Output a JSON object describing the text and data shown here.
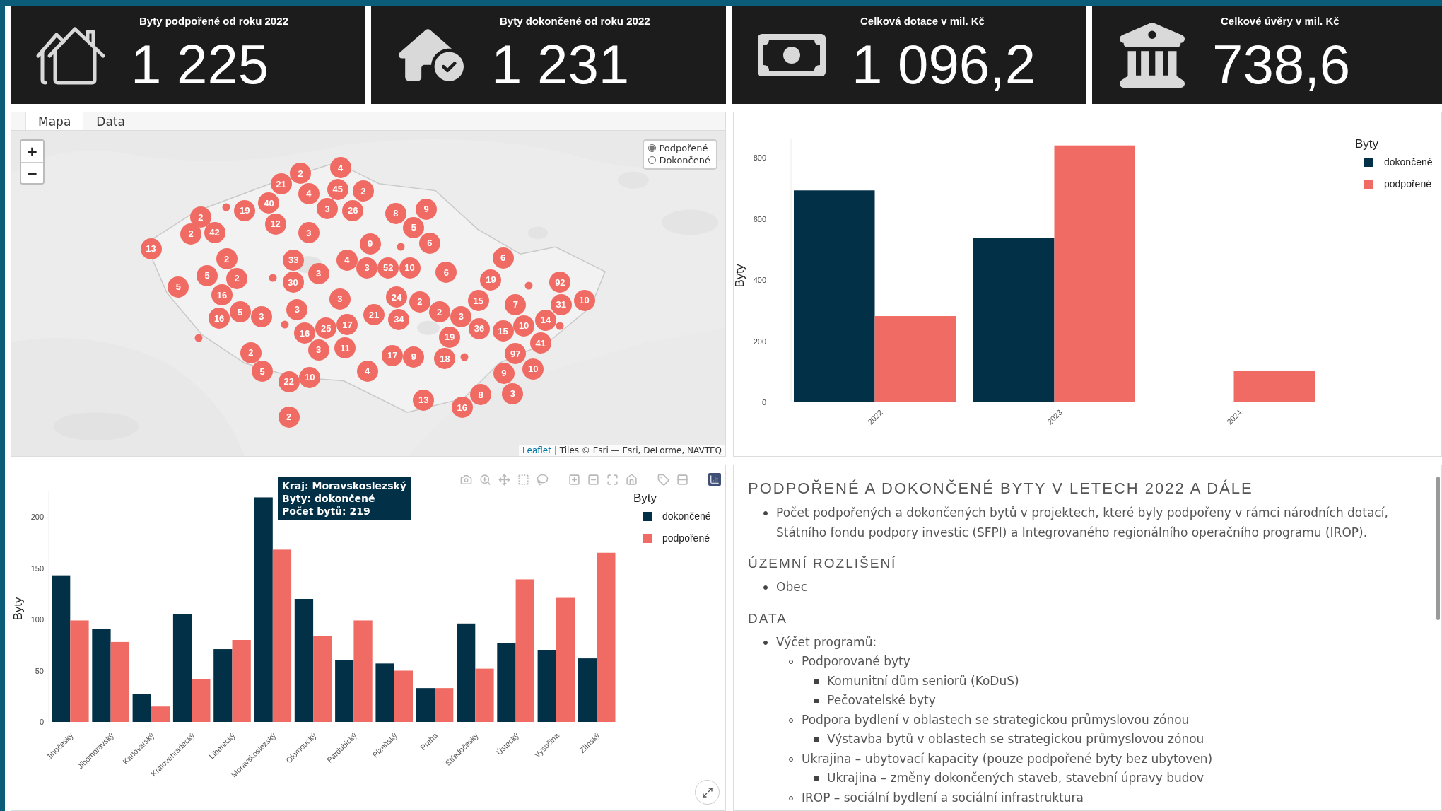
{
  "kpis": [
    {
      "kind": "houses",
      "title": "Byty podpořené od roku 2022",
      "value": "1 225"
    },
    {
      "kind": "house-check",
      "title": "Byty dokončené od roku 2022",
      "value": "1 231"
    },
    {
      "kind": "banknote",
      "title": "Celková dotace v mil. Kč",
      "value": "1 096,2"
    },
    {
      "kind": "bank",
      "title": "Celkové úvěry v mil. Kč",
      "value": "738,6"
    }
  ],
  "map_panel": {
    "tabs": [
      {
        "label": "Mapa",
        "selected": true
      },
      {
        "label": "Data",
        "selected": false
      }
    ],
    "zoom_controls": [
      "+",
      "−"
    ],
    "layer_options": [
      {
        "label": "Podpořené",
        "selected": true
      },
      {
        "label": "Dokončené",
        "selected": false
      }
    ],
    "markers": [
      {
        "kind": "cluster",
        "count": "2"
      },
      {
        "kind": "cluster",
        "count": "4"
      },
      {
        "kind": "cluster",
        "count": "21"
      },
      {
        "kind": "cluster",
        "count": "4"
      },
      {
        "kind": "cluster",
        "count": "45"
      },
      {
        "kind": "cluster",
        "count": "2"
      },
      {
        "kind": "point"
      },
      {
        "kind": "cluster",
        "count": "19"
      },
      {
        "kind": "cluster",
        "count": "40"
      },
      {
        "kind": "cluster",
        "count": "3"
      },
      {
        "kind": "cluster",
        "count": "26"
      },
      {
        "kind": "cluster",
        "count": "8"
      },
      {
        "kind": "cluster",
        "count": "9"
      },
      {
        "kind": "cluster",
        "count": "2"
      },
      {
        "kind": "cluster",
        "count": "12"
      },
      {
        "kind": "cluster",
        "count": "2"
      },
      {
        "kind": "cluster",
        "count": "42"
      },
      {
        "kind": "cluster",
        "count": "3"
      },
      {
        "kind": "cluster",
        "count": "5"
      },
      {
        "kind": "cluster",
        "count": "13"
      },
      {
        "kind": "cluster",
        "count": "9"
      },
      {
        "kind": "point"
      },
      {
        "kind": "cluster",
        "count": "6"
      },
      {
        "kind": "cluster",
        "count": "2"
      },
      {
        "kind": "cluster",
        "count": "33"
      },
      {
        "kind": "cluster",
        "count": "4"
      },
      {
        "kind": "cluster",
        "count": "6"
      },
      {
        "kind": "cluster",
        "count": "5"
      },
      {
        "kind": "cluster",
        "count": "3"
      },
      {
        "kind": "cluster",
        "count": "3"
      },
      {
        "kind": "cluster",
        "count": "52"
      },
      {
        "kind": "cluster",
        "count": "10"
      },
      {
        "kind": "cluster",
        "count": "6"
      },
      {
        "kind": "cluster",
        "count": "5"
      },
      {
        "kind": "cluster",
        "count": "2"
      },
      {
        "kind": "point"
      },
      {
        "kind": "cluster",
        "count": "30"
      },
      {
        "kind": "cluster",
        "count": "19"
      },
      {
        "kind": "point"
      },
      {
        "kind": "cluster",
        "count": "92"
      },
      {
        "kind": "cluster",
        "count": "16"
      },
      {
        "kind": "cluster",
        "count": "3"
      },
      {
        "kind": "cluster",
        "count": "24"
      },
      {
        "kind": "cluster",
        "count": "2"
      },
      {
        "kind": "cluster",
        "count": "15"
      },
      {
        "kind": "cluster",
        "count": "7"
      },
      {
        "kind": "cluster",
        "count": "31"
      },
      {
        "kind": "cluster",
        "count": "10"
      },
      {
        "kind": "cluster",
        "count": "16"
      },
      {
        "kind": "cluster",
        "count": "5"
      },
      {
        "kind": "cluster",
        "count": "3"
      },
      {
        "kind": "cluster",
        "count": "3"
      },
      {
        "kind": "cluster",
        "count": "21"
      },
      {
        "kind": "cluster",
        "count": "2"
      },
      {
        "kind": "cluster",
        "count": "3"
      },
      {
        "kind": "point"
      },
      {
        "kind": "cluster",
        "count": "25"
      },
      {
        "kind": "cluster",
        "count": "17"
      },
      {
        "kind": "cluster",
        "count": "34"
      },
      {
        "kind": "cluster",
        "count": "36"
      },
      {
        "kind": "cluster",
        "count": "10"
      },
      {
        "kind": "cluster",
        "count": "14"
      },
      {
        "kind": "point"
      },
      {
        "kind": "point"
      },
      {
        "kind": "cluster",
        "count": "16"
      },
      {
        "kind": "cluster",
        "count": "15"
      },
      {
        "kind": "cluster",
        "count": "3"
      },
      {
        "kind": "cluster",
        "count": "11"
      },
      {
        "kind": "cluster",
        "count": "19"
      },
      {
        "kind": "cluster",
        "count": "41"
      },
      {
        "kind": "cluster",
        "count": "2"
      },
      {
        "kind": "cluster",
        "count": "17"
      },
      {
        "kind": "cluster",
        "count": "9"
      },
      {
        "kind": "cluster",
        "count": "18"
      },
      {
        "kind": "point"
      },
      {
        "kind": "cluster",
        "count": "97"
      },
      {
        "kind": "cluster",
        "count": "5"
      },
      {
        "kind": "cluster",
        "count": "10"
      },
      {
        "kind": "cluster",
        "count": "4"
      },
      {
        "kind": "cluster",
        "count": "9"
      },
      {
        "kind": "cluster",
        "count": "10"
      },
      {
        "kind": "cluster",
        "count": "22"
      },
      {
        "kind": "cluster",
        "count": "13"
      },
      {
        "kind": "cluster",
        "count": "8"
      },
      {
        "kind": "cluster",
        "count": "3"
      },
      {
        "kind": "cluster",
        "count": "16"
      },
      {
        "kind": "cluster",
        "count": "2"
      }
    ],
    "attribution": {
      "link": "Leaflet",
      "text": "| Tiles © Esri — Esri, DeLorme, NAVTEQ"
    }
  },
  "year_chart": {
    "chart_data": {
      "type": "bar",
      "ylabel": "Byty",
      "legend": {
        "title": "Byty"
      },
      "ylim": [
        0,
        860
      ],
      "categories": [
        "2022",
        "2023",
        "2024"
      ],
      "series": [
        {
          "name": "dokončené",
          "color": "#023047",
          "values": [
            693,
            538,
            null
          ]
        },
        {
          "name": "podpořené",
          "color": "#f06b63",
          "values": [
            282,
            840,
            103
          ]
        }
      ],
      "yticks": [
        0,
        200,
        400,
        600,
        800
      ]
    }
  },
  "region_chart": {
    "tooltip": [
      "Kraj: Moravskoslezský",
      "Byty: dokončené",
      "Počet bytů: 219"
    ],
    "chart_data": {
      "type": "bar",
      "ylabel": "Byty",
      "legend": {
        "title": "Byty"
      },
      "ylim": [
        0,
        225
      ],
      "categories": [
        "Jihočeský",
        "Jihomoravský",
        "Karlovarský",
        "Královéhradecký",
        "Liberecký",
        "Moravskoslezský",
        "Olomoucký",
        "Pardubický",
        "Plzeňský",
        "Praha",
        "Středočeský",
        "Ústecký",
        "Vysočina",
        "Zlínský"
      ],
      "series": [
        {
          "name": "dokončené",
          "color": "#023047",
          "values": [
            143,
            91,
            27,
            105,
            71,
            219,
            120,
            60,
            57,
            33,
            96,
            77,
            70,
            62
          ]
        },
        {
          "name": "podpořené",
          "color": "#f06b63",
          "values": [
            99,
            78,
            15,
            42,
            80,
            168,
            84,
            99,
            50,
            33,
            52,
            139,
            121,
            165
          ]
        }
      ],
      "yticks": [
        0,
        50,
        100,
        150,
        200
      ]
    }
  },
  "notes": {
    "sections": [
      {
        "heading": "PODPOŘENÉ A DOKONČENÉ BYTY V LETECH 2022 A DÁLE",
        "items": [
          {
            "text": "Počet podpořených a dokončených bytů v projektech, které byly podpořeny v rámci národních dotací, Státního fondu podpory investic (SFPI) a Integrovaného regionálního operačního programu (IROP)."
          }
        ]
      },
      {
        "heading": "ÚZEMNÍ ROZLIŠENÍ",
        "items": [
          {
            "text": "Obec"
          }
        ]
      },
      {
        "heading": "DATA",
        "items": [
          {
            "text": "Výčet programů:",
            "children": [
              {
                "text": "Podporované byty",
                "children": [
                  {
                    "text": "Komunitní dům seniorů (KoDuS)"
                  },
                  {
                    "text": "Pečovatelské byty"
                  }
                ]
              },
              {
                "text": "Podpora bydlení v oblastech se strategickou průmyslovou zónou",
                "children": [
                  {
                    "text": "Výstavba bytů v oblastech se strategickou průmyslovou zónou"
                  }
                ]
              },
              {
                "text": "Ukrajina – ubytovací kapacity (pouze podpořené byty bez ubytoven)",
                "children": [
                  {
                    "text": "Ukrajina – změny dokončených staveb, stavební úpravy budov"
                  }
                ]
              },
              {
                "text": "IROP – sociální bydlení a sociální infrastruktura"
              }
            ]
          }
        ]
      }
    ]
  }
}
